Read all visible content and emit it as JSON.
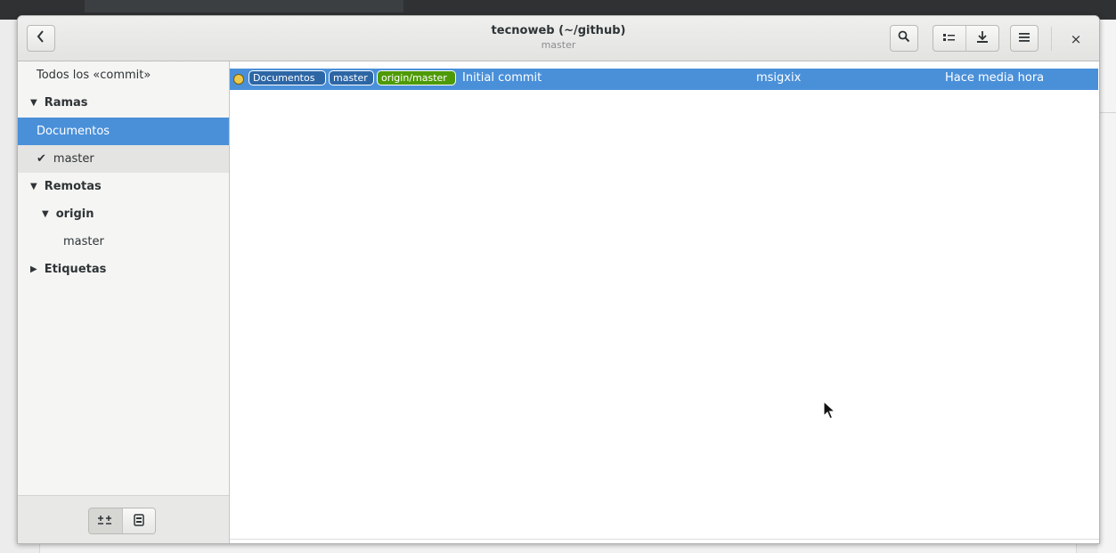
{
  "window": {
    "title": "tecnoweb (~/github)",
    "subtitle": "master"
  },
  "header": {
    "back_icon": "chevron-left-icon",
    "search_icon": "search-icon",
    "list_view_icon": "list-icon",
    "download_icon": "download-icon",
    "menu_icon": "hamburger-menu-icon",
    "close_label": "×"
  },
  "sidebar": {
    "all_commits": "Todos los «commit»",
    "branches_header": "Ramas",
    "branches": [
      {
        "label": "Documentos",
        "selected": true
      },
      {
        "label": "master",
        "current": true,
        "check": "✔"
      }
    ],
    "remotes_header": "Remotas",
    "remote_name": "origin",
    "remote_branches": [
      "master"
    ],
    "tags_header": "Etiquetas"
  },
  "history": {
    "rows": [
      {
        "refs": [
          "Documentos",
          "master",
          "origin/master"
        ],
        "subject": "Initial commit",
        "author": "msigxix",
        "date": "Hace media hora"
      }
    ]
  },
  "colors": {
    "selection": "#4a90d9",
    "local_ref": "#2d66a5",
    "remote_ref": "#4e9a06",
    "commit_dot": "#ecc94b"
  }
}
